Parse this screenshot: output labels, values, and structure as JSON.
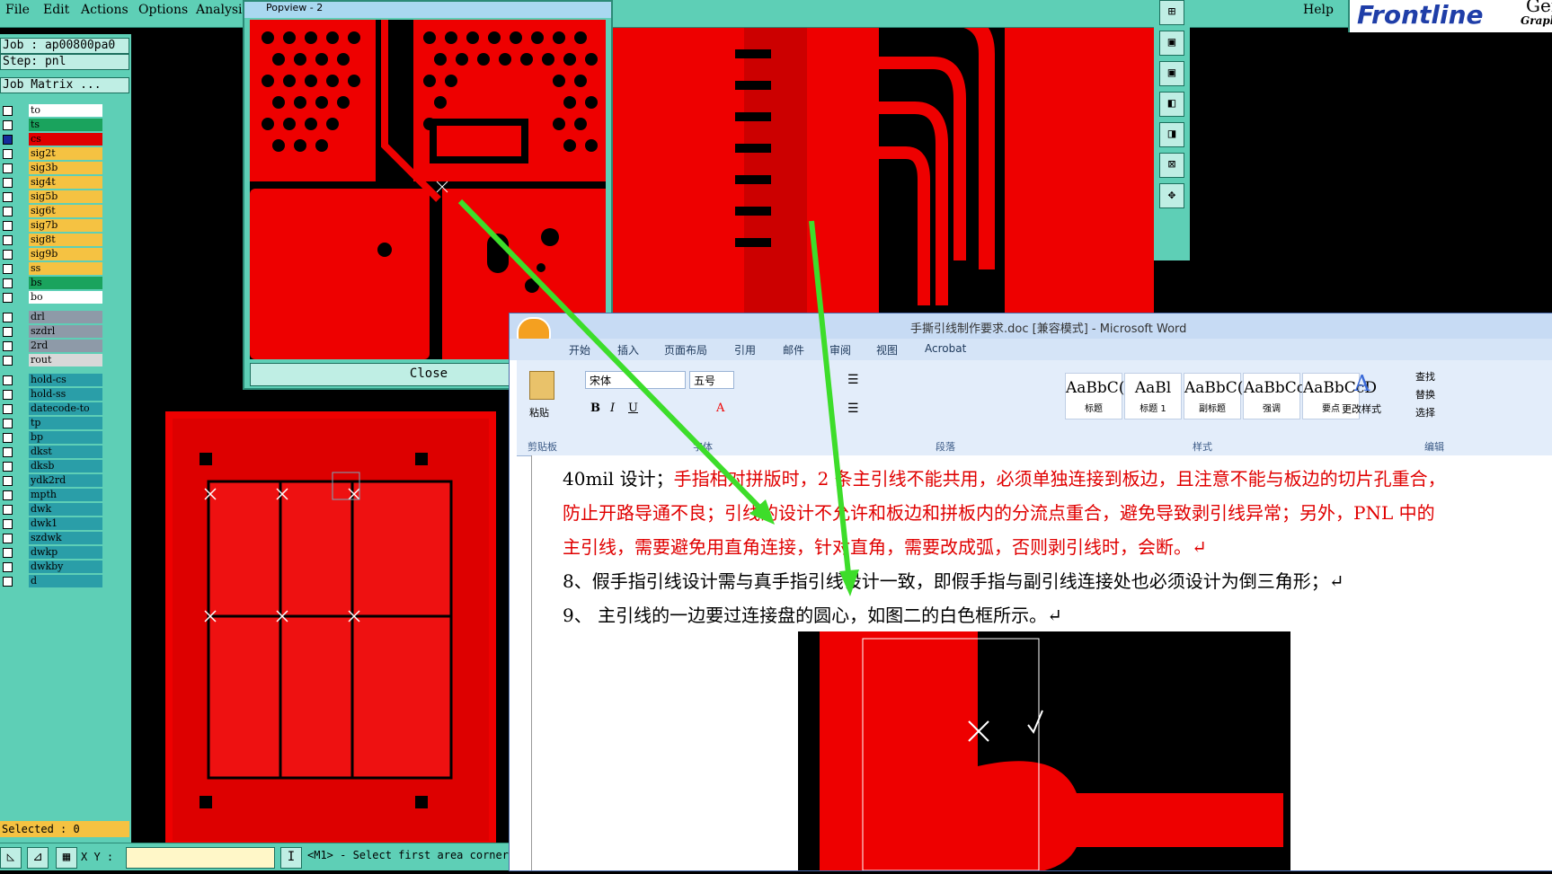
{
  "menu": {
    "file": "File",
    "edit": "Edit",
    "actions": "Actions",
    "options": "Options",
    "analysis": "Analysis",
    "help": "Help"
  },
  "brand": {
    "name": "Frontline",
    "word2": "Gene",
    "word3": "Graph"
  },
  "job": {
    "job": "Job : ap00800pa0",
    "step": "Step: pnl",
    "matrix": "Job Matrix ..."
  },
  "layers": [
    {
      "name": "to",
      "color": "#ffffff",
      "checked": false
    },
    {
      "name": "ts",
      "color": "#1aa35d",
      "checked": false
    },
    {
      "name": "cs",
      "color": "#e00000",
      "checked": true
    },
    {
      "name": "sig2t",
      "color": "#f5c242",
      "checked": false
    },
    {
      "name": "sig3b",
      "color": "#f5c242",
      "checked": false
    },
    {
      "name": "sig4t",
      "color": "#f5c242",
      "checked": false
    },
    {
      "name": "sig5b",
      "color": "#f5c242",
      "checked": false
    },
    {
      "name": "sig6t",
      "color": "#f5c242",
      "checked": false
    },
    {
      "name": "sig7b",
      "color": "#f5c242",
      "checked": false
    },
    {
      "name": "sig8t",
      "color": "#f5c242",
      "checked": false
    },
    {
      "name": "sig9b",
      "color": "#f5c242",
      "checked": false
    },
    {
      "name": "ss",
      "color": "#f5c242",
      "checked": false
    },
    {
      "name": "bs",
      "color": "#1aa35d",
      "checked": false
    },
    {
      "name": "bo",
      "color": "#ffffff",
      "checked": false
    }
  ],
  "layers2": [
    {
      "name": "drl",
      "color": "#8e9aa8"
    },
    {
      "name": "szdrl",
      "color": "#8e9aa8"
    },
    {
      "name": "2rd",
      "color": "#8e9aa8"
    },
    {
      "name": "rout",
      "color": "#d8d8d8"
    }
  ],
  "layers3": [
    {
      "name": "hold-cs",
      "color": "#2a9ea8"
    },
    {
      "name": "hold-ss",
      "color": "#2a9ea8"
    },
    {
      "name": "datecode-to",
      "color": "#2a9ea8"
    },
    {
      "name": "tp",
      "color": "#2a9ea8"
    },
    {
      "name": "bp",
      "color": "#2a9ea8"
    },
    {
      "name": "dkst",
      "color": "#2a9ea8"
    },
    {
      "name": "dksb",
      "color": "#2a9ea8"
    },
    {
      "name": "ydk2rd",
      "color": "#2a9ea8"
    },
    {
      "name": "mpth",
      "color": "#2a9ea8"
    },
    {
      "name": "dwk",
      "color": "#2a9ea8"
    },
    {
      "name": "dwk1",
      "color": "#2a9ea8"
    },
    {
      "name": "szdwk",
      "color": "#2a9ea8"
    },
    {
      "name": "dwkp",
      "color": "#2a9ea8"
    },
    {
      "name": "dwkby",
      "color": "#2a9ea8"
    },
    {
      "name": "d",
      "color": "#2a9ea8"
    }
  ],
  "status": {
    "selected": "Selected : 0",
    "xy_label": "X Y :",
    "message": "<M1> - Select first area corner"
  },
  "popview": {
    "title": "Popview - 2",
    "close": "Close"
  },
  "word": {
    "title": "手撕引线制作要求.doc [兼容模式] - Microsoft Word",
    "tabs": [
      "开始",
      "插入",
      "页面布局",
      "引用",
      "邮件",
      "审阅",
      "视图",
      "Acrobat"
    ],
    "font_name": "宋体",
    "font_size": "五号",
    "groups": {
      "clipboard": "剪贴板",
      "font": "字体",
      "paragraph": "段落",
      "styles": "样式",
      "editing": "编辑"
    },
    "paste": "粘贴",
    "styles": [
      {
        "sample": "AaBbC(",
        "name": "标题"
      },
      {
        "sample": "AaBl",
        "name": "标题 1"
      },
      {
        "sample": "AaBbC(",
        "name": "副标题"
      },
      {
        "sample": "AaBbCcDd",
        "name": "强调"
      },
      {
        "sample": "AaBbCcD",
        "name": "要点"
      }
    ],
    "change_styles": "更改样式",
    "find": "查找",
    "replace": "替换",
    "select": "选择",
    "lines": {
      "l1a": "40mil 设计；",
      "l1b": "手指相对拼版时，2 条主引线不能共用，必须单独连接到板边，且注意不能与板边的切片孔重合，",
      "l2": "防止开路导通不良；引线的设计不允许和板边和拼板内的分流点重合，避免导致剥引线异常；另外，PNL 中的",
      "l3": "主引线，需要避免用直角连接，针对直角，需要改成弧，否则剥引线时，会断。↵",
      "l4": "8、假手指引线设计需与真手指引线设计一致，即假手指与副引线连接处也必须设计为倒三角形；↵",
      "l5": "9、  主引线的一边要过连接盘的圆心，如图二的白色框所示。↵"
    }
  }
}
